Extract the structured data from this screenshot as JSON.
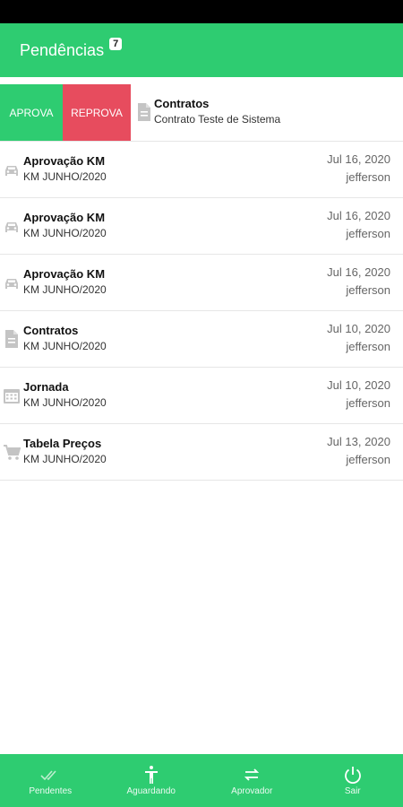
{
  "header": {
    "title": "Pendências",
    "badge": "7",
    "color": "#2ecc71"
  },
  "swipe": {
    "approve_label": "APROVA",
    "reject_label": "REPROVA",
    "approve_color": "#2ecc71",
    "reject_color": "#e74c5e"
  },
  "items": [
    {
      "icon": "document-icon",
      "title": "Contratos",
      "subtitle": "Contrato Teste de Sistema",
      "date": "",
      "user": ""
    },
    {
      "icon": "car-icon",
      "title": "Aprovação KM",
      "subtitle": "KM JUNHO/2020",
      "date": "Jul 16, 2020",
      "user": "jefferson"
    },
    {
      "icon": "car-icon",
      "title": "Aprovação KM",
      "subtitle": "KM JUNHO/2020",
      "date": "Jul 16, 2020",
      "user": "jefferson"
    },
    {
      "icon": "car-icon",
      "title": "Aprovação KM",
      "subtitle": "KM JUNHO/2020",
      "date": "Jul 16, 2020",
      "user": "jefferson"
    },
    {
      "icon": "document-icon",
      "title": "Contratos",
      "subtitle": "KM JUNHO/2020",
      "date": "Jul 10, 2020",
      "user": "jefferson"
    },
    {
      "icon": "calendar-icon",
      "title": "Jornada",
      "subtitle": "KM JUNHO/2020",
      "date": "Jul 10, 2020",
      "user": "jefferson"
    },
    {
      "icon": "cart-icon",
      "title": "Tabela Preços",
      "subtitle": "KM JUNHO/2020",
      "date": "Jul 13, 2020",
      "user": "jefferson"
    }
  ],
  "nav": {
    "pendentes": "Pendentes",
    "aguardando": "Aguardando",
    "aprovador": "Aprovador",
    "sair": "Sair"
  }
}
